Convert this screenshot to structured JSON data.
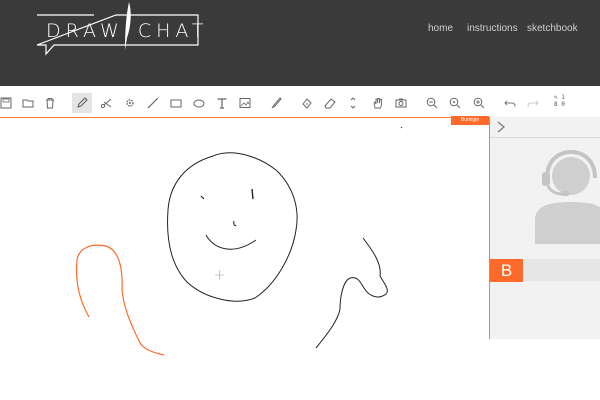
{
  "header": {
    "logo_text": "DRAW CHAT",
    "logo_part1": "DRAW",
    "logo_part2": "CHAT",
    "nav": [
      {
        "label": "home"
      },
      {
        "label": "instructions"
      },
      {
        "label": "sketchbook"
      }
    ]
  },
  "toolbar": {
    "stroke_counter_line1": "1",
    "stroke_counter_line2": "8 0",
    "tools": [
      {
        "name": "save-icon"
      },
      {
        "name": "folder-icon"
      },
      {
        "name": "trash-icon"
      },
      {
        "name": "pencil-icon",
        "active": true
      },
      {
        "name": "scissors-icon"
      },
      {
        "name": "gear-icon"
      },
      {
        "name": "line-icon"
      },
      {
        "name": "rectangle-icon"
      },
      {
        "name": "ellipse-icon"
      },
      {
        "name": "text-icon"
      },
      {
        "name": "image-icon"
      },
      {
        "name": "brush-icon"
      },
      {
        "name": "fill-icon"
      },
      {
        "name": "eraser-icon"
      },
      {
        "name": "stroke-size-icon"
      },
      {
        "name": "hand-icon"
      },
      {
        "name": "camera-icon"
      },
      {
        "name": "zoom-out-icon"
      },
      {
        "name": "zoom-reset-icon"
      },
      {
        "name": "zoom-in-icon"
      },
      {
        "name": "undo-icon"
      },
      {
        "name": "redo-icon"
      }
    ]
  },
  "canvas": {
    "user_tag": "Bumigje"
  },
  "panel": {
    "user_initial": "B"
  },
  "colors": {
    "header_bg": "#3a3a3a",
    "accent": "#ff6a2a",
    "panel_bg": "#f2f2f2"
  }
}
